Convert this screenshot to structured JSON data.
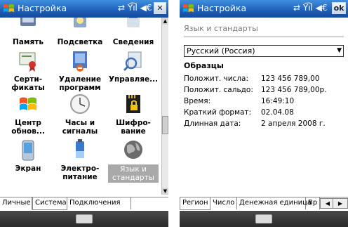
{
  "colors": {
    "title_bar": "#1f5fb8",
    "selected_item": "#a9a9a9",
    "bottom_bar": "#2a2a2a"
  },
  "left": {
    "title": "Настройка",
    "status_icons": "⇄ Y͡ıl ◀€",
    "close_label": "✕",
    "grid": [
      {
        "label": "Память",
        "icon": "memory-icon"
      },
      {
        "label": "Подсветка",
        "icon": "backlight-icon"
      },
      {
        "label": "Сведения",
        "icon": "info-icon"
      },
      {
        "label": "Серти-\nфикаты",
        "icon": "certificates-icon"
      },
      {
        "label": "Удаление\nпрограмм",
        "icon": "remove-programs-icon"
      },
      {
        "label": "Управляе...",
        "icon": "managed-programs-icon"
      },
      {
        "label": "Центр\nобнов...",
        "icon": "update-center-icon"
      },
      {
        "label": "Часы и\nсигналы",
        "icon": "clock-icon"
      },
      {
        "label": "Шифро-\nвание",
        "icon": "encryption-icon"
      },
      {
        "label": "Экран",
        "icon": "screen-icon"
      },
      {
        "label": "Электро-\nпитание",
        "icon": "power-icon"
      },
      {
        "label": "Язык и\nстандарты",
        "icon": "regional-settings-icon",
        "selected": true
      }
    ],
    "tabs": [
      "Личные",
      "Система",
      "Подключения"
    ],
    "active_tab": "Система"
  },
  "right": {
    "title": "Настройка",
    "status_icons": "⇄ Y͡ıl ◀€",
    "ok_label": "ok",
    "section_title": "Язык и стандарты",
    "locale": "Русский (Россия)",
    "samples_label": "Образцы",
    "samples": [
      {
        "label": "Положит. числа:",
        "value": "123 456 789,00"
      },
      {
        "label": "Положит. сальдо:",
        "value": "123 456 789,00р."
      },
      {
        "label": "Время:",
        "value": "16:49:10"
      },
      {
        "label": "Краткий формат:",
        "value": "02.04.08"
      },
      {
        "label": "Длинная дата:",
        "value": "2 апреля 2008 г."
      }
    ],
    "tabs": [
      "Регион",
      "Число",
      "Денежная единица",
      "Вр"
    ],
    "active_tab": "Регион"
  }
}
